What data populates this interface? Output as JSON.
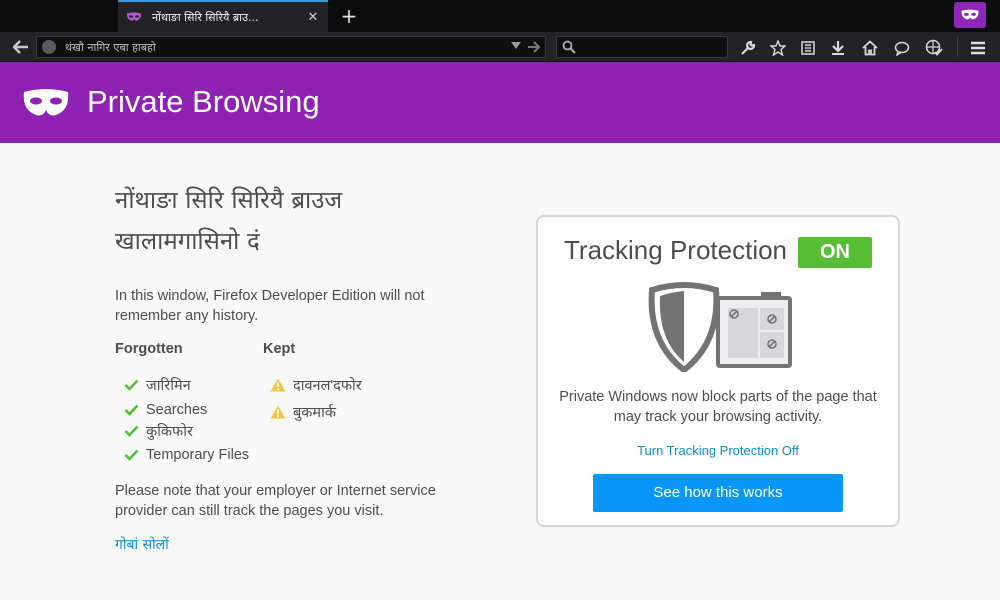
{
  "tab": {
    "title": "नोंथाङा सिरि सिरियै ब्राउ...",
    "favicon": "private-mask-icon",
    "close_label": "✕"
  },
  "new_tab_label": "+",
  "urlbar": {
    "text": "थंखौ नागिर एबा हाबहो"
  },
  "searchbar": {
    "value": ""
  },
  "toolbar_icons": [
    "wrench-icon",
    "star-icon",
    "reading-list-icon",
    "download-icon",
    "home-icon",
    "chat-icon",
    "globe-check-icon",
    "menu-icon"
  ],
  "banner": {
    "title": "Private Browsing",
    "color": "#8f22b3"
  },
  "main": {
    "heading_line1": "नोंथाङा सिरि सिरियै ब्राउज",
    "heading_line2": "खालामगासिनो दं",
    "intro": "In this window, Firefox Developer Edition will not remember any history.",
    "forgotten_header": "Forgotten",
    "kept_header": "Kept",
    "forgotten_items": [
      "जारिमिन",
      "Searches",
      "कुकिफोर",
      "Temporary Files"
    ],
    "kept_items": [
      "दावनल'दफोर",
      "बुकमार्क"
    ],
    "note": "Please note that your employer or Internet service provider can still track the pages you visit.",
    "learn_more": "गोबां सोलों"
  },
  "tracking": {
    "title": "Tracking Protection",
    "status": "ON",
    "status_color": "#57bd35",
    "description": "Private Windows now block parts of the page that may track your browsing activity.",
    "toggle_link": "Turn Tracking Protection Off",
    "button": "See how this works",
    "button_color": "#0996f8"
  }
}
